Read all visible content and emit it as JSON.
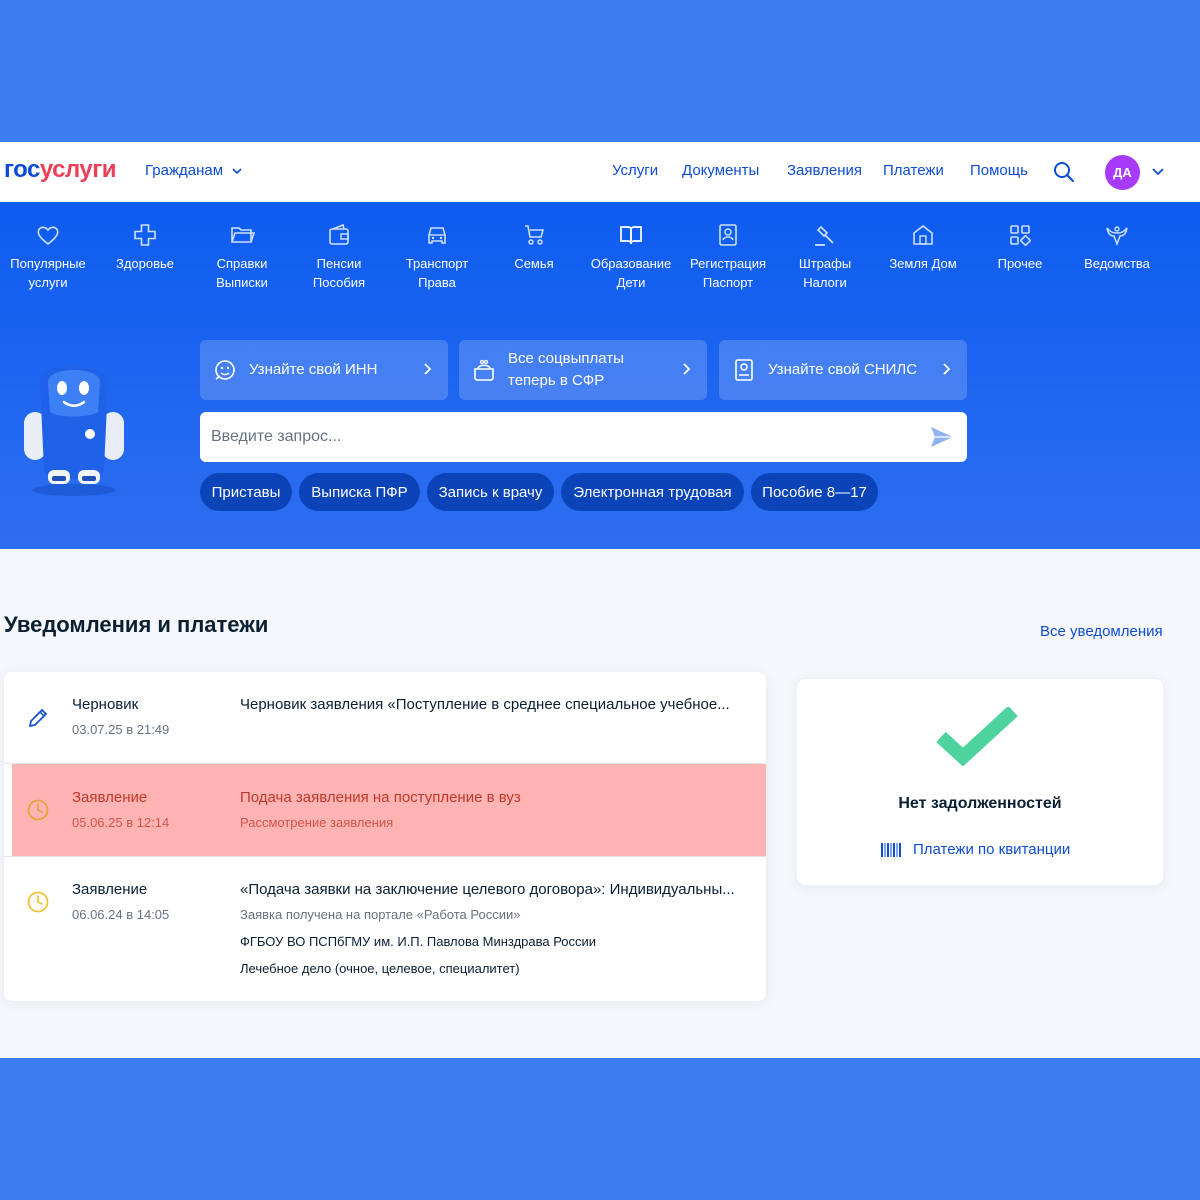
{
  "header": {
    "logo_part1": "гос",
    "logo_part2": "услуги",
    "audience": "Гражданам",
    "nav": [
      "Услуги",
      "Документы",
      "Заявления",
      "Платежи",
      "Помощь"
    ],
    "avatar_initials": "ДА"
  },
  "categories": [
    {
      "line1": "Популярные",
      "line2": "услуги",
      "icon": "heart-icon"
    },
    {
      "line1": "Здоровье",
      "line2": "",
      "icon": "cross-icon"
    },
    {
      "line1": "Справки",
      "line2": "Выписки",
      "icon": "folder-icon"
    },
    {
      "line1": "Пенсии",
      "line2": "Пособия",
      "icon": "wallet-icon"
    },
    {
      "line1": "Транспорт",
      "line2": "Права",
      "icon": "car-icon"
    },
    {
      "line1": "Семья",
      "line2": "",
      "icon": "stroller-icon"
    },
    {
      "line1": "Образование",
      "line2": "Дети",
      "icon": "book-icon"
    },
    {
      "line1": "Регистрация",
      "line2": "Паспорт",
      "icon": "passport-icon"
    },
    {
      "line1": "Штрафы",
      "line2": "Налоги",
      "icon": "gavel-icon"
    },
    {
      "line1": "Земля Дом",
      "line2": "",
      "icon": "house-icon"
    },
    {
      "line1": "Прочее",
      "line2": "",
      "icon": "grid-icon"
    },
    {
      "line1": "Ведомства",
      "line2": "",
      "icon": "eagle-icon"
    }
  ],
  "promos": [
    {
      "line1": "Узнайте свой ИНН",
      "line2": "",
      "icon": "face-icon"
    },
    {
      "line1": "Все соцвыплаты",
      "line2": "теперь в СФР",
      "icon": "purse-icon"
    },
    {
      "line1": "Узнайте свой СНИЛС",
      "line2": "",
      "icon": "card-icon"
    }
  ],
  "search": {
    "placeholder": "Введите запрос..."
  },
  "quick_chips": [
    "Приставы",
    "Выписка ПФР",
    "Запись к врачу",
    "Электронная трудовая",
    "Пособие 8—17"
  ],
  "notifications": {
    "title": "Уведомления и платежи",
    "all_link": "Все уведомления",
    "items": [
      {
        "type": "Черновик",
        "date": "03.07.25 в 21:49",
        "title": "Черновик заявления «Поступление в среднее специальное учебное...",
        "icon": "pencil-icon",
        "icon_color": "#0d4cd3"
      },
      {
        "type": "Заявление",
        "date": "05.06.25 в 12:14",
        "title": "Подача заявления на поступление в вуз",
        "subtitle": "Рассмотрение заявления",
        "icon": "clock-icon",
        "icon_color": "#e8a23a"
      },
      {
        "type": "Заявление",
        "date": "06.06.24 в 14:05",
        "title": "«Подача заявки на заключение целевого договора»: Индивидуальны...",
        "subtitle": "Заявка получена на портале «Работа России»",
        "line3": "ФГБОУ ВО ПСПбГМУ им. И.П. Павлова Минздрава России",
        "line4": "Лечебное дело (очное, целевое, специалитет)",
        "icon": "clock-icon",
        "icon_color": "#f0c238"
      }
    ]
  },
  "debts": {
    "status": "Нет задолженностей",
    "link": "Платежи по квитанции",
    "check_color": "#4fd39e"
  },
  "colors": {
    "brand_blue": "#0d4cd3",
    "brand_red": "#ee3f58",
    "hero_blue": "#0d5cf0",
    "avatar": "#a73afd",
    "highlight": "#ffb3b3"
  }
}
